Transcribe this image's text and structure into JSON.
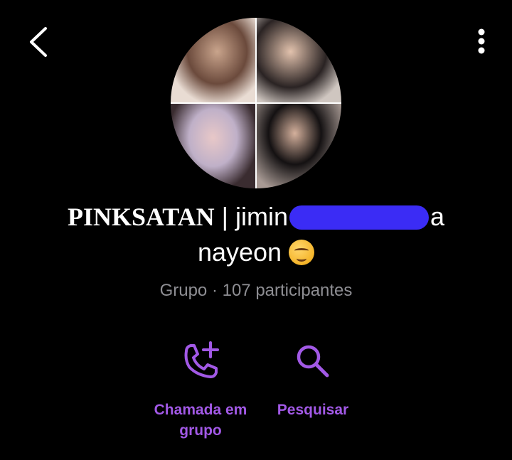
{
  "header": {
    "back_icon": "chevron-left-icon",
    "menu_icon": "more-vertical-icon"
  },
  "group": {
    "avatar": "group-photo-collage",
    "title_brand": "PINKSATAN",
    "title_rest_prefix": " | jimin",
    "title_rest_suffix": "a",
    "title_line2": "nayeon",
    "title_emoji": "drooling-face-emoji",
    "subtitle": "Grupo · 107 participantes"
  },
  "actions": {
    "call_label_1": "Chamada em",
    "call_label_2": "grupo",
    "call_icon": "phone-add-icon",
    "search_label": "Pesquisar",
    "search_icon": "search-icon"
  },
  "colors": {
    "accent": "#a259e6",
    "background": "#000000",
    "subtitle": "#8e8e93",
    "redaction": "#3b2cf5"
  }
}
